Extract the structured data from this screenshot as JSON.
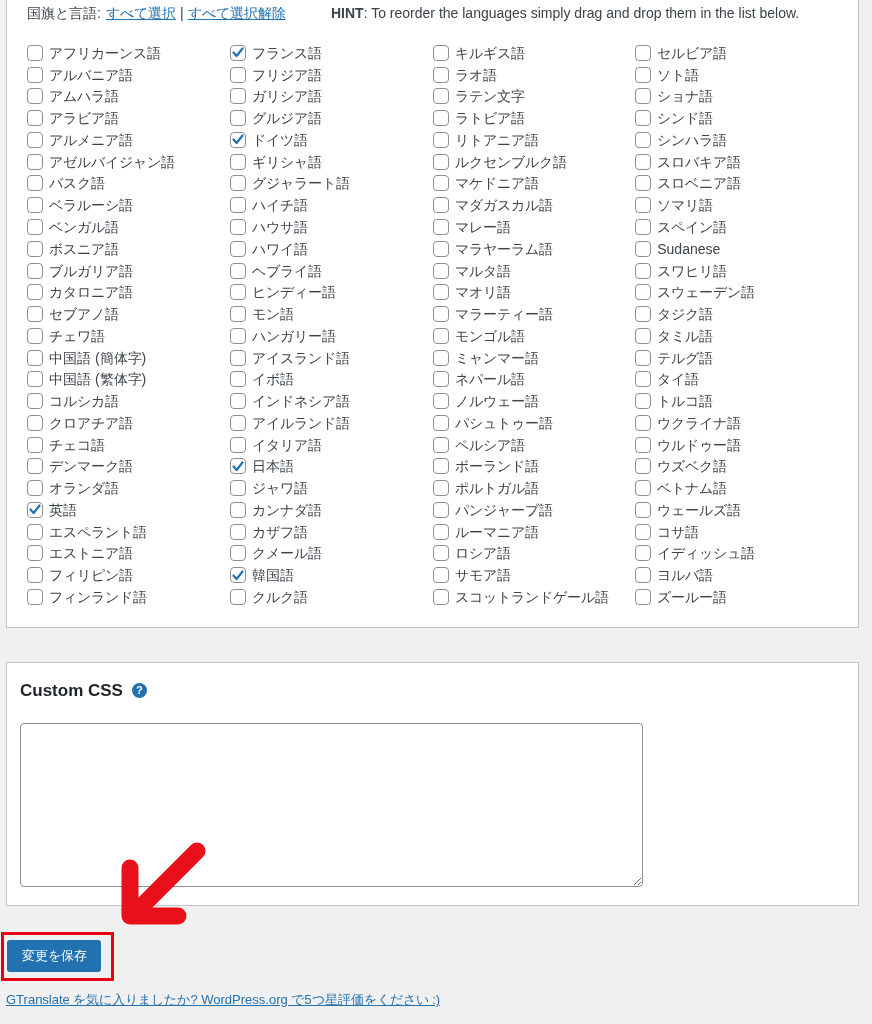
{
  "languages_header": {
    "label": "国旗と言語:",
    "select_all": "すべて選択",
    "separator": "|",
    "deselect_all": "すべて選択解除",
    "hint": "**HINT**: To reorder the languages simply drag and drop them in the list below."
  },
  "language_columns": [
    [
      {
        "label": "アフリカーンス語",
        "checked": false
      },
      {
        "label": "アルバニア語",
        "checked": false
      },
      {
        "label": "アムハラ語",
        "checked": false
      },
      {
        "label": "アラビア語",
        "checked": false
      },
      {
        "label": "アルメニア語",
        "checked": false
      },
      {
        "label": "アゼルバイジャン語",
        "checked": false
      },
      {
        "label": "バスク語",
        "checked": false
      },
      {
        "label": "ベラルーシ語",
        "checked": false
      },
      {
        "label": "ベンガル語",
        "checked": false
      },
      {
        "label": "ボスニア語",
        "checked": false
      },
      {
        "label": "ブルガリア語",
        "checked": false
      },
      {
        "label": "カタロニア語",
        "checked": false
      },
      {
        "label": "セブアノ語",
        "checked": false
      },
      {
        "label": "チェワ語",
        "checked": false
      },
      {
        "label": "中国語 (簡体字)",
        "checked": false
      },
      {
        "label": "中国語 (繁体字)",
        "checked": false
      },
      {
        "label": "コルシカ語",
        "checked": false
      },
      {
        "label": "クロアチア語",
        "checked": false
      },
      {
        "label": "チェコ語",
        "checked": false
      },
      {
        "label": "デンマーク語",
        "checked": false
      },
      {
        "label": "オランダ語",
        "checked": false
      },
      {
        "label": "英語",
        "checked": true
      },
      {
        "label": "エスペラント語",
        "checked": false
      },
      {
        "label": "エストニア語",
        "checked": false
      },
      {
        "label": "フィリピン語",
        "checked": false
      },
      {
        "label": "フィンランド語",
        "checked": false
      }
    ],
    [
      {
        "label": "フランス語",
        "checked": true
      },
      {
        "label": "フリジア語",
        "checked": false
      },
      {
        "label": "ガリシア語",
        "checked": false
      },
      {
        "label": "グルジア語",
        "checked": false
      },
      {
        "label": "ドイツ語",
        "checked": true
      },
      {
        "label": "ギリシャ語",
        "checked": false
      },
      {
        "label": "グジャラート語",
        "checked": false
      },
      {
        "label": "ハイチ語",
        "checked": false
      },
      {
        "label": "ハウサ語",
        "checked": false
      },
      {
        "label": "ハワイ語",
        "checked": false
      },
      {
        "label": "ヘブライ語",
        "checked": false
      },
      {
        "label": "ヒンディー語",
        "checked": false
      },
      {
        "label": "モン語",
        "checked": false
      },
      {
        "label": "ハンガリー語",
        "checked": false
      },
      {
        "label": "アイスランド語",
        "checked": false
      },
      {
        "label": "イボ語",
        "checked": false
      },
      {
        "label": "インドネシア語",
        "checked": false
      },
      {
        "label": "アイルランド語",
        "checked": false
      },
      {
        "label": "イタリア語",
        "checked": false
      },
      {
        "label": "日本語",
        "checked": true
      },
      {
        "label": "ジャワ語",
        "checked": false
      },
      {
        "label": "カンナダ語",
        "checked": false
      },
      {
        "label": "カザフ語",
        "checked": false
      },
      {
        "label": "クメール語",
        "checked": false
      },
      {
        "label": "韓国語",
        "checked": true
      },
      {
        "label": "クルク語",
        "checked": false
      }
    ],
    [
      {
        "label": "キルギス語",
        "checked": false
      },
      {
        "label": "ラオ語",
        "checked": false
      },
      {
        "label": "ラテン文字",
        "checked": false
      },
      {
        "label": "ラトビア語",
        "checked": false
      },
      {
        "label": "リトアニア語",
        "checked": false
      },
      {
        "label": "ルクセンブルク語",
        "checked": false
      },
      {
        "label": "マケドニア語",
        "checked": false
      },
      {
        "label": "マダガスカル語",
        "checked": false
      },
      {
        "label": "マレー語",
        "checked": false
      },
      {
        "label": "マラヤーラム語",
        "checked": false
      },
      {
        "label": "マルタ語",
        "checked": false
      },
      {
        "label": "マオリ語",
        "checked": false
      },
      {
        "label": "マラーティー語",
        "checked": false
      },
      {
        "label": "モンゴル語",
        "checked": false
      },
      {
        "label": "ミャンマー語",
        "checked": false
      },
      {
        "label": "ネパール語",
        "checked": false
      },
      {
        "label": "ノルウェー語",
        "checked": false
      },
      {
        "label": "パシュトゥー語",
        "checked": false
      },
      {
        "label": "ペルシア語",
        "checked": false
      },
      {
        "label": "ポーランド語",
        "checked": false
      },
      {
        "label": "ポルトガル語",
        "checked": false
      },
      {
        "label": "パンジャーブ語",
        "checked": false
      },
      {
        "label": "ルーマニア語",
        "checked": false
      },
      {
        "label": "ロシア語",
        "checked": false
      },
      {
        "label": "サモア語",
        "checked": false
      },
      {
        "label": "スコットランドゲール語",
        "checked": false
      }
    ],
    [
      {
        "label": "セルビア語",
        "checked": false
      },
      {
        "label": "ソト語",
        "checked": false
      },
      {
        "label": "ショナ語",
        "checked": false
      },
      {
        "label": "シンド語",
        "checked": false
      },
      {
        "label": "シンハラ語",
        "checked": false
      },
      {
        "label": "スロバキア語",
        "checked": false
      },
      {
        "label": "スロベニア語",
        "checked": false
      },
      {
        "label": "ソマリ語",
        "checked": false
      },
      {
        "label": "スペイン語",
        "checked": false
      },
      {
        "label": "Sudanese",
        "checked": false
      },
      {
        "label": "スワヒリ語",
        "checked": false
      },
      {
        "label": "スウェーデン語",
        "checked": false
      },
      {
        "label": "タジク語",
        "checked": false
      },
      {
        "label": "タミル語",
        "checked": false
      },
      {
        "label": "テルグ語",
        "checked": false
      },
      {
        "label": "タイ語",
        "checked": false
      },
      {
        "label": "トルコ語",
        "checked": false
      },
      {
        "label": "ウクライナ語",
        "checked": false
      },
      {
        "label": "ウルドゥー語",
        "checked": false
      },
      {
        "label": "ウズベク語",
        "checked": false
      },
      {
        "label": "ベトナム語",
        "checked": false
      },
      {
        "label": "ウェールズ語",
        "checked": false
      },
      {
        "label": "コサ語",
        "checked": false
      },
      {
        "label": "イディッシュ語",
        "checked": false
      },
      {
        "label": "ヨルバ語",
        "checked": false
      },
      {
        "label": "ズールー語",
        "checked": false
      }
    ]
  ],
  "custom_css": {
    "title": "Custom CSS",
    "help_icon": "?"
  },
  "save_button": "変更を保存",
  "footer_link": "GTranslate を気に入りましたか? WordPress.org で5つ星評価をください :)"
}
